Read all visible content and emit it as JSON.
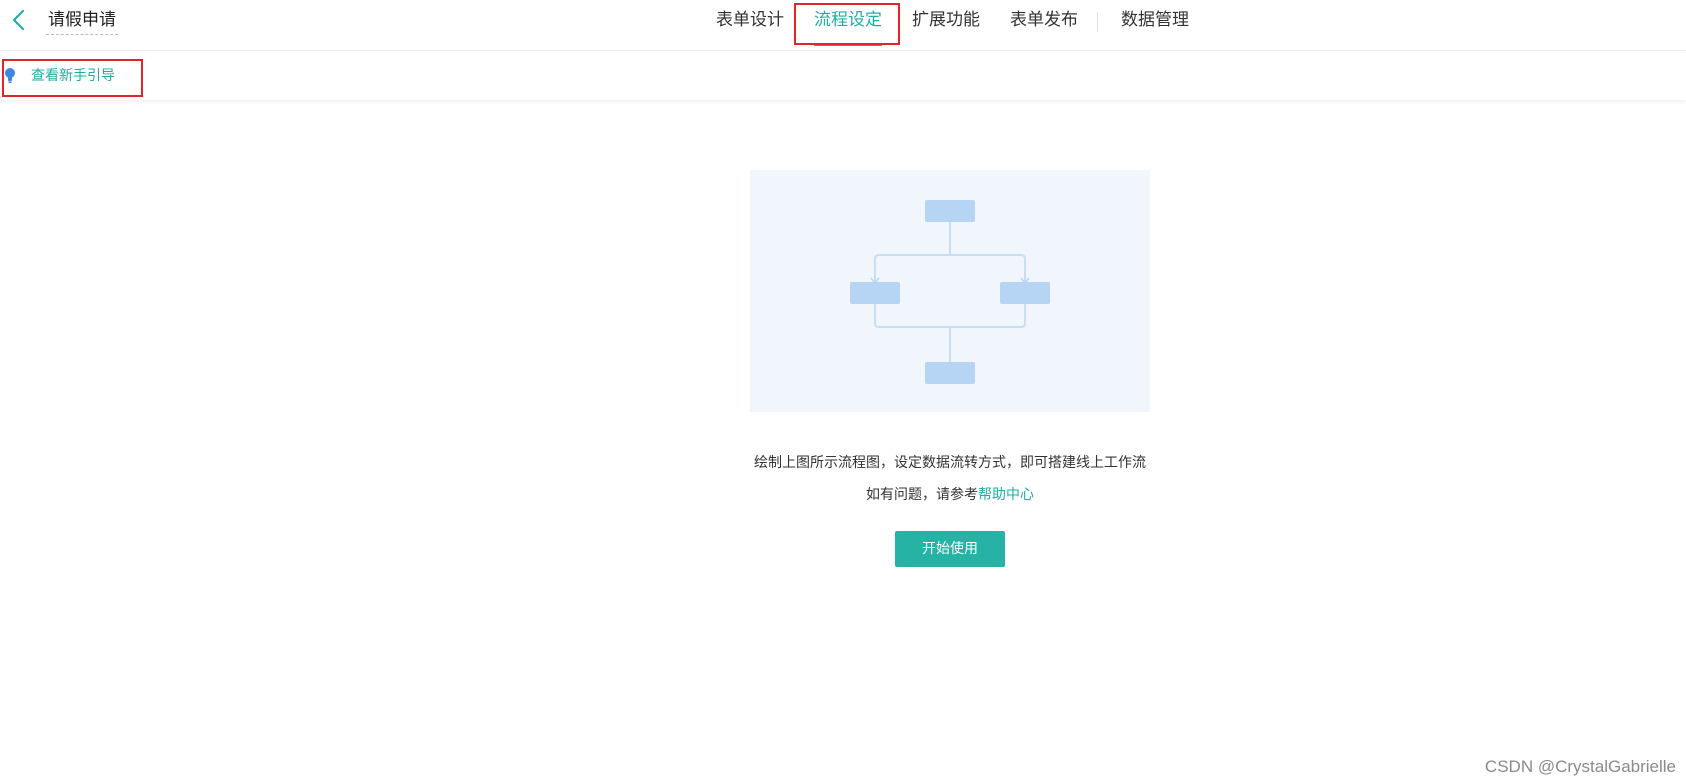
{
  "header": {
    "title": "请假申请",
    "tabs": [
      {
        "label": "表单设计",
        "active": false
      },
      {
        "label": "流程设定",
        "active": true
      },
      {
        "label": "扩展功能",
        "active": false
      },
      {
        "label": "表单发布",
        "active": false
      },
      {
        "label": "数据管理",
        "active": false
      }
    ]
  },
  "toolbar": {
    "guide_label": "查看新手引导"
  },
  "main": {
    "description": "绘制上图所示流程图，设定数据流转方式，即可搭建线上工作流",
    "help_prefix": "如有问题，请参考",
    "help_link": "帮助中心",
    "start_button": "开始使用"
  },
  "watermark": "CSDN @CrystalGabrielle",
  "colors": {
    "accent": "#1fada3",
    "button": "#26b2a4",
    "highlight_box": "#e0262b",
    "illustration_bg": "#f1f6fd",
    "flow_node": "#b6d4f3"
  },
  "icons": {
    "back": "chevron-left-icon",
    "guide": "lightbulb-icon"
  }
}
